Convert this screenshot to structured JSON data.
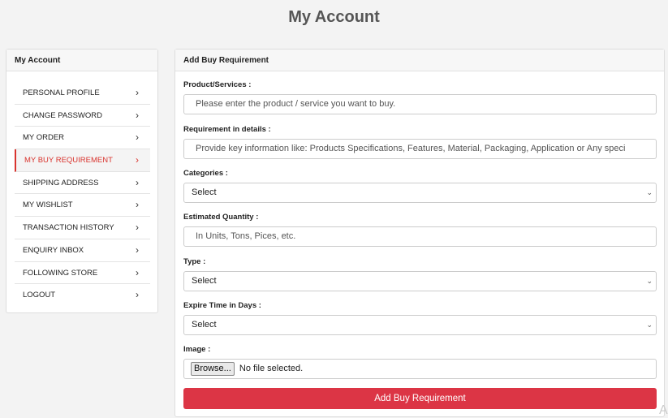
{
  "page_title": "My Account",
  "sidebar": {
    "title": "My Account",
    "items": [
      {
        "label": "PERSONAL PROFILE",
        "icon": "chevron-right-icon"
      },
      {
        "label": "CHANGE PASSWORD",
        "icon": "chevron-right-icon"
      },
      {
        "label": "MY ORDER",
        "icon": "chevron-right-icon"
      },
      {
        "label": "MY BUY REQUIREMENT",
        "icon": "chevron-right-icon",
        "active": true
      },
      {
        "label": "SHIPPING ADDRESS",
        "icon": "chevron-right-icon"
      },
      {
        "label": "MY WISHLIST",
        "icon": "chevron-right-icon"
      },
      {
        "label": "TRANSACTION HISTORY",
        "icon": "chevron-right-icon"
      },
      {
        "label": "ENQUIRY INBOX",
        "icon": "chevron-right-icon"
      },
      {
        "label": "FOLLOWING STORE",
        "icon": "chevron-right-icon"
      },
      {
        "label": "LOGOUT",
        "icon": "chevron-right-icon"
      }
    ]
  },
  "form": {
    "title": "Add Buy Requirement",
    "product": {
      "label": "Product/Services :",
      "placeholder": "Please enter the product / service you want to buy."
    },
    "details": {
      "label": "Requirement in details :",
      "placeholder": "Provide key information like: Products Specifications, Features, Material, Packaging, Application or Any speci"
    },
    "categories": {
      "label": "Categories :",
      "value": "Select"
    },
    "quantity": {
      "label": "Estimated Quantity :",
      "placeholder": "In Units, Tons, Pices, etc."
    },
    "type": {
      "label": "Type :",
      "value": "Select"
    },
    "expire": {
      "label": "Expire Time in Days :",
      "value": "Select"
    },
    "image": {
      "label": "Image :",
      "browse_label": "Browse...",
      "status": "No file selected."
    },
    "submit_label": "Add Buy Requirement"
  },
  "corner_glyph": "A",
  "colors": {
    "accent": "#dc3545",
    "active_text": "#d9342e",
    "background": "#f3f3f3"
  }
}
